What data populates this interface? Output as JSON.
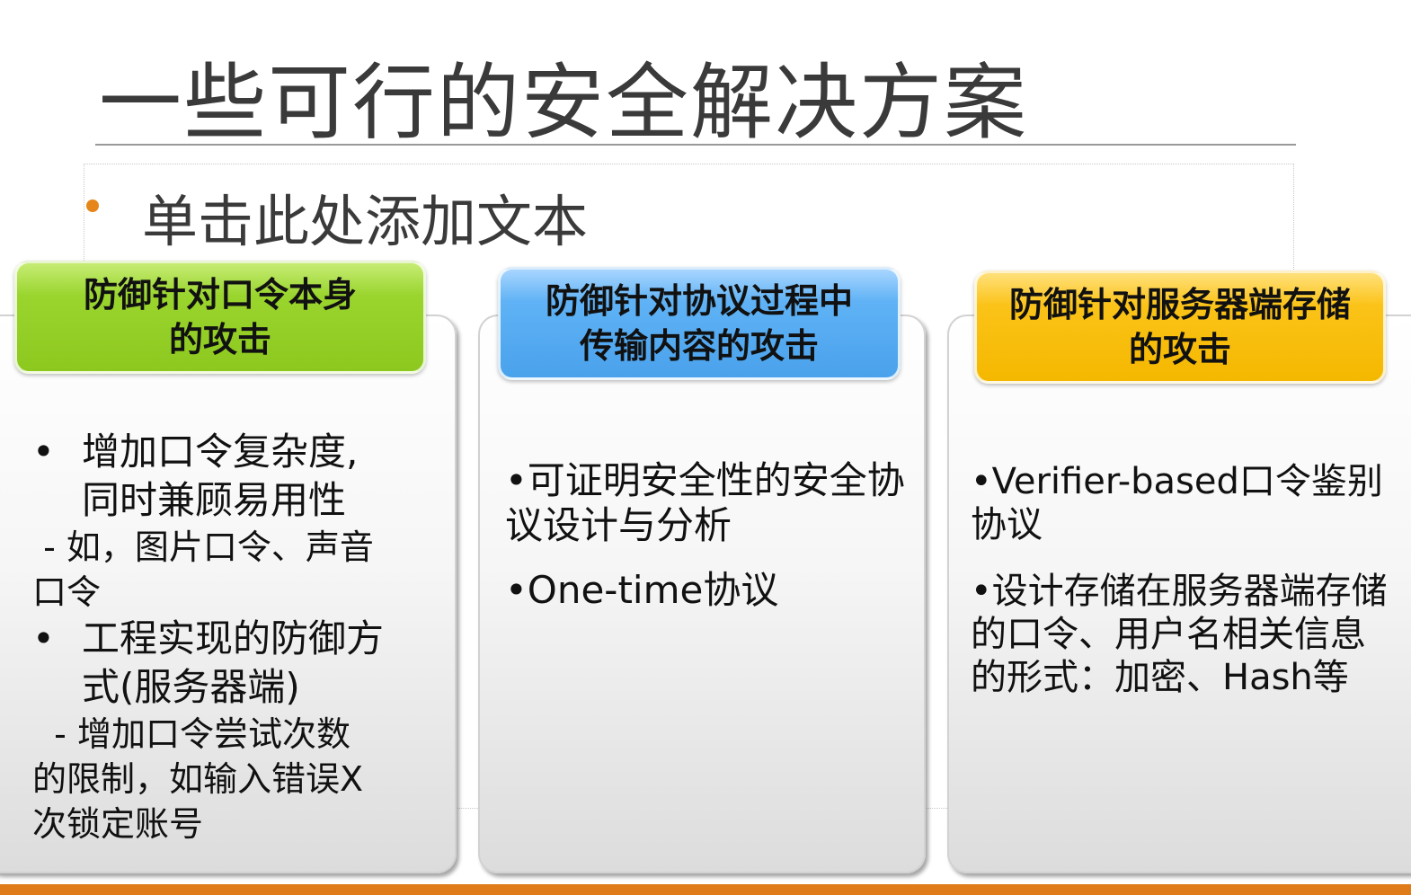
{
  "slide": {
    "title": "一些可行的安全解决方案",
    "placeholder": "单击此处添加文本",
    "accent_color": "#e07b19"
  },
  "columns": [
    {
      "header_line1": "防御针对口令本身",
      "header_line2": "的攻击",
      "color": "#8dc81f",
      "items": [
        {
          "bullet": "•",
          "text_line1": "增加口令复杂度,",
          "text_line2": "同时兼顾易用性",
          "sub_line1": " - 如，图片口令、声音",
          "sub_line2": "口令"
        },
        {
          "bullet": "•",
          "text_line1": "工程实现的防御方",
          "text_line2": "式(服务器端)",
          "sub_line1": "  - 增加口令尝试次数",
          "sub_line2": "的限制，如输入错误X",
          "sub_line3": "次锁定账号"
        }
      ]
    },
    {
      "header_line1": "防御针对协议过程中",
      "header_line2": "传输内容的攻击",
      "color": "#4aa2ec",
      "items": [
        {
          "text": "•可证明安全性的安全协议设计与分析"
        },
        {
          "text": "•One-time协议"
        }
      ]
    },
    {
      "header_line1": "防御针对服务器端存储",
      "header_line2": "的攻击",
      "color": "#f5b800",
      "items": [
        {
          "text": "•Verifier-based口令鉴别协议"
        },
        {
          "text": "•设计存储在服务器端存储的口令、用户名相关信息的形式：加密、Hash等"
        }
      ]
    }
  ]
}
